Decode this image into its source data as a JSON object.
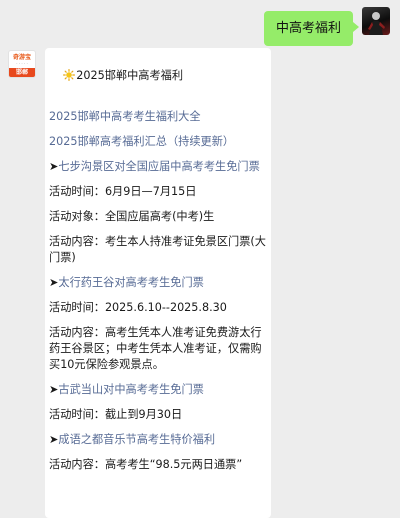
{
  "outgoing_message": {
    "text": "中高考福利"
  },
  "bot": {
    "avatar_logo_top": "奇游宝",
    "avatar_logo_bottom": "邯郸"
  },
  "reply": {
    "title": "2025邯郸中高考福利",
    "link1": "2025邯郸中高考考生福利大全",
    "link2": "2025邯郸高考福利汇总（持续更新）",
    "item1": {
      "arrow": "➤",
      "link": "七步沟景区对全国应届中高考考生免门票",
      "time": "活动时间：6月9日—7月15日",
      "target": "活动对象：全国应届高考(中考)生",
      "content_l1": "活动内容：考生本人持准考证免景区门票(大",
      "content_l2": "门票)"
    },
    "item2": {
      "arrow": "➤",
      "link": "太行药王谷对高考考生免门票",
      "time": "活动时间：2025.6.10--2025.8.30",
      "content_l1": "活动内容：高考生凭本人准考证免费游太行",
      "content_l2": "药王谷景区；中考生凭本人准考证，仅需购",
      "content_l3": "买10元保险参观景点。"
    },
    "item3": {
      "arrow": "➤",
      "link": "古武当山对中高考考生免门票",
      "time": "活动时间：截止到9月30日"
    },
    "item4": {
      "arrow": "➤",
      "link": "成语之都音乐节高考生特价福利",
      "content_l1": "活动内容：高考考生“98.5元两日通票”"
    }
  }
}
